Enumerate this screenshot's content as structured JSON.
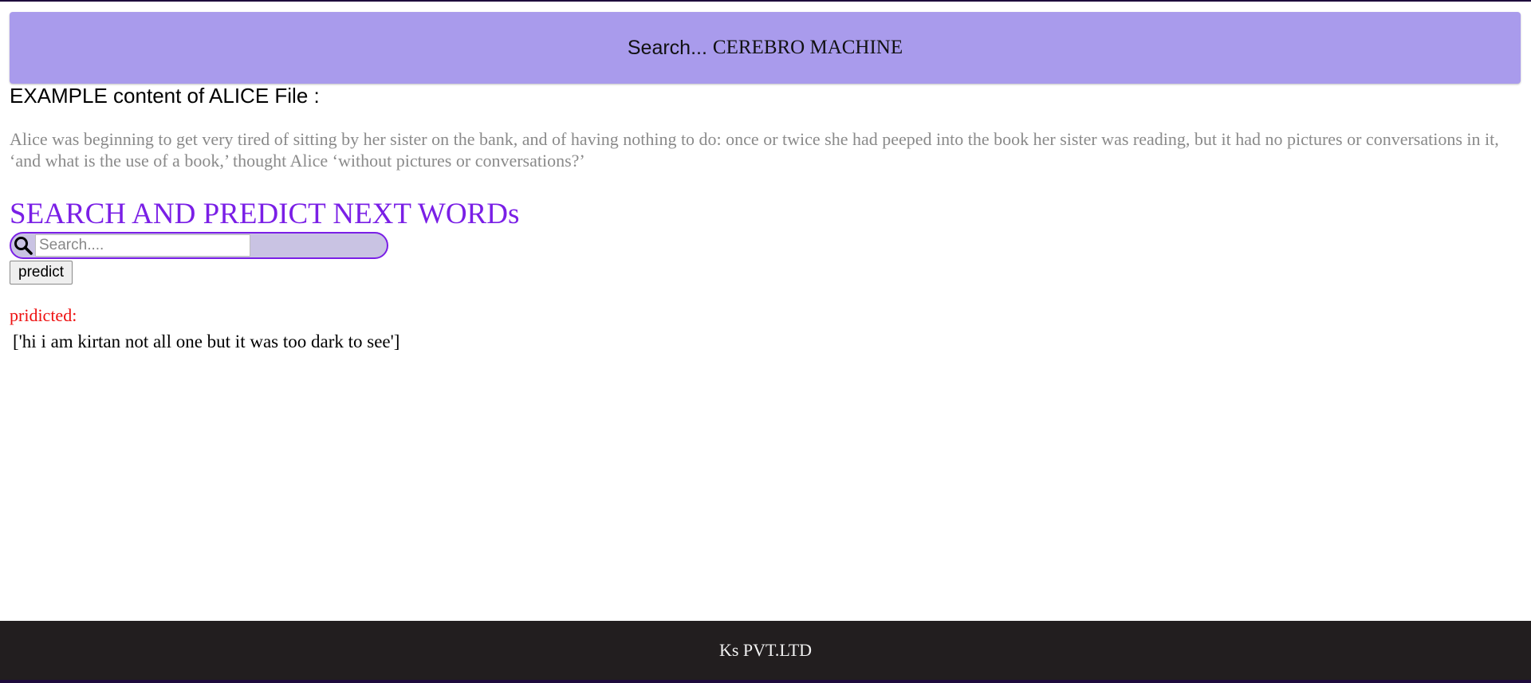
{
  "header": {
    "search_text": "Search...",
    "brand": "CEREBRO MACHINE"
  },
  "example": {
    "title": "EXAMPLE content of ALICE File :",
    "text": "Alice was beginning to get very tired of sitting by her sister on the bank, and of having nothing to do: once or twice she had peeped into the book her sister was reading, but it had no pictures or conversations in it, ‘and what is the use of a book,’ thought Alice ‘without pictures or conversations?’"
  },
  "section": {
    "title": "SEARCH AND PREDICT NEXT WORDs"
  },
  "search": {
    "placeholder": "Search....",
    "value": "",
    "icon": "search-icon"
  },
  "predict_button": {
    "label": "predict"
  },
  "result": {
    "label": "pridicted:",
    "value": "['hi i am kirtan not all one but it was too dark to see']"
  },
  "footer": {
    "text": "Ks PVT.LTD"
  },
  "colors": {
    "header_bg": "#a99bec",
    "accent": "#7a1fe6",
    "predicted_label": "#ee1010",
    "footer_bg": "#221e1f"
  }
}
